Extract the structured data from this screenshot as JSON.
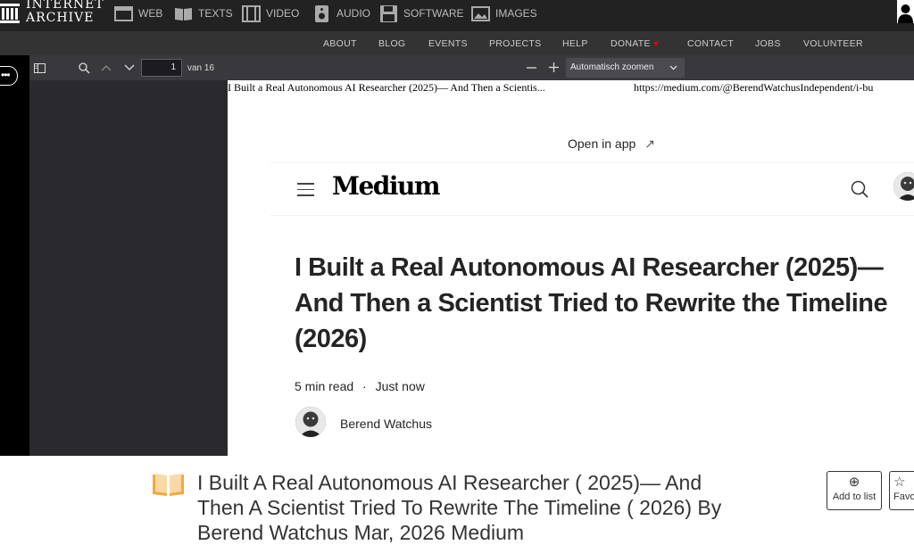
{
  "topnav": {
    "logo_line1": "INTERNET",
    "logo_line2": "ARCHIVE",
    "media": [
      {
        "label": "WEB",
        "icon": "web-icon"
      },
      {
        "label": "TEXTS",
        "icon": "book-icon"
      },
      {
        "label": "VIDEO",
        "icon": "film-icon"
      },
      {
        "label": "AUDIO",
        "icon": "speaker-icon"
      },
      {
        "label": "SOFTWARE",
        "icon": "floppy-icon"
      },
      {
        "label": "IMAGES",
        "icon": "image-icon"
      }
    ]
  },
  "subnav": {
    "items": [
      "ABOUT",
      "BLOG",
      "EVENTS",
      "PROJECTS",
      "HELP",
      "DONATE",
      "CONTACT",
      "JOBS",
      "VOLUNTEER"
    ],
    "donate_heart": "♥"
  },
  "viewer": {
    "page_number": "1",
    "page_of": "van 16",
    "zoom": "Automatisch zoomen"
  },
  "pdf": {
    "header_title": "I Built a Real Autonomous AI Researcher (2025)— And Then a Scientis...",
    "header_url": "https://medium.com/@BerendWatchusIndependent/i-bu",
    "open_in_app": "Open in app",
    "open_in_app_arrow": "↗",
    "wordmark": "Medium",
    "title": "I Built a Real Autonomous AI Researcher (2025)— And Then a Scientist Tried to Rewrite the Timeline (2026)",
    "read_time": "5 min read",
    "dot": "·",
    "posted": "Just now",
    "author": "Berend Watchus"
  },
  "item": {
    "title": "I Built A Real Autonomous AI Researcher ( 2025)— And Then A Scientist Tried To Rewrite The Timeline ( 2026) By Berend Watchus Mar, 2026 Medium",
    "actions": [
      {
        "label": "Add to list",
        "symbol": "⊕"
      },
      {
        "label": "Favorite",
        "symbol": "☆"
      }
    ]
  },
  "colors": {
    "topbar": "#222222",
    "subbar": "#333333",
    "viewer_toolbar": "#38383d",
    "viewer_sidebar": "#2a2a2e",
    "donate_heart": "#e0001a",
    "book_icon": "#f4a83d"
  }
}
